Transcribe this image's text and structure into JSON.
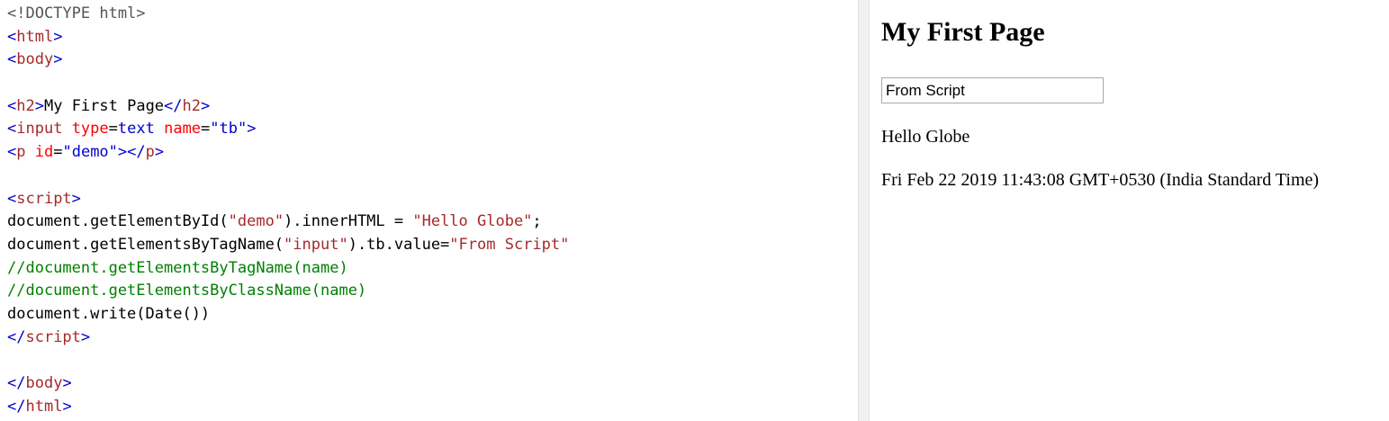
{
  "editor": {
    "lines": [
      [
        {
          "t": "<!DOCTYPE html>",
          "c": "doctype"
        }
      ],
      [
        {
          "t": "<",
          "c": "bracket"
        },
        {
          "t": "html",
          "c": "tag"
        },
        {
          "t": ">",
          "c": "bracket"
        }
      ],
      [
        {
          "t": "<",
          "c": "bracket"
        },
        {
          "t": "body",
          "c": "tag"
        },
        {
          "t": ">",
          "c": "bracket"
        }
      ],
      [],
      [
        {
          "t": "<",
          "c": "bracket"
        },
        {
          "t": "h2",
          "c": "tag"
        },
        {
          "t": ">",
          "c": "bracket"
        },
        {
          "t": "My First Page",
          "c": "plain"
        },
        {
          "t": "</",
          "c": "bracket"
        },
        {
          "t": "h2",
          "c": "tag"
        },
        {
          "t": ">",
          "c": "bracket"
        }
      ],
      [
        {
          "t": "<",
          "c": "bracket"
        },
        {
          "t": "input",
          "c": "tag"
        },
        {
          "t": " ",
          "c": "plain"
        },
        {
          "t": "type",
          "c": "attr"
        },
        {
          "t": "=",
          "c": "plain"
        },
        {
          "t": "text",
          "c": "value"
        },
        {
          "t": " ",
          "c": "plain"
        },
        {
          "t": "name",
          "c": "attr"
        },
        {
          "t": "=",
          "c": "plain"
        },
        {
          "t": "\"tb\"",
          "c": "value"
        },
        {
          "t": ">",
          "c": "bracket"
        }
      ],
      [
        {
          "t": "<",
          "c": "bracket"
        },
        {
          "t": "p",
          "c": "tag"
        },
        {
          "t": " ",
          "c": "plain"
        },
        {
          "t": "id",
          "c": "attr"
        },
        {
          "t": "=",
          "c": "plain"
        },
        {
          "t": "\"demo\"",
          "c": "value"
        },
        {
          "t": "></",
          "c": "bracket"
        },
        {
          "t": "p",
          "c": "tag"
        },
        {
          "t": ">",
          "c": "bracket"
        }
      ],
      [],
      [
        {
          "t": "<",
          "c": "bracket"
        },
        {
          "t": "script",
          "c": "tag"
        },
        {
          "t": ">",
          "c": "bracket"
        }
      ],
      [
        {
          "t": "document.getElementById(",
          "c": "plain"
        },
        {
          "t": "\"demo\"",
          "c": "string"
        },
        {
          "t": ").innerHTML = ",
          "c": "plain"
        },
        {
          "t": "\"Hello Globe\"",
          "c": "string"
        },
        {
          "t": ";",
          "c": "plain"
        }
      ],
      [
        {
          "t": "document.getElementsByTagName(",
          "c": "plain"
        },
        {
          "t": "\"input\"",
          "c": "string"
        },
        {
          "t": ").tb.value=",
          "c": "plain"
        },
        {
          "t": "\"From Script\"",
          "c": "string"
        }
      ],
      [
        {
          "t": "//document.getElementsByTagName(name)",
          "c": "comment"
        }
      ],
      [
        {
          "t": "//document.getElementsByClassName(name)",
          "c": "comment"
        }
      ],
      [
        {
          "t": "document.write(Date())",
          "c": "plain"
        }
      ],
      [
        {
          "t": "</",
          "c": "bracket"
        },
        {
          "t": "script",
          "c": "tag"
        },
        {
          "t": ">",
          "c": "bracket"
        }
      ],
      [],
      [
        {
          "t": "</",
          "c": "bracket"
        },
        {
          "t": "body",
          "c": "tag"
        },
        {
          "t": ">",
          "c": "bracket"
        }
      ],
      [
        {
          "t": "</",
          "c": "bracket"
        },
        {
          "t": "html",
          "c": "tag"
        },
        {
          "t": ">",
          "c": "bracket"
        }
      ]
    ]
  },
  "preview": {
    "heading": "My First Page",
    "input_value": "From Script",
    "paragraph": "Hello Globe",
    "date_output": "Fri Feb 22 2019 11:43:08 GMT+0530 (India Standard Time)"
  },
  "colors": {
    "tag": "#a52a2a",
    "bracket": "#0000cd",
    "attr": "#ff0000",
    "value": "#0000cd",
    "string": "#a52a2a",
    "comment": "#008000",
    "doctype": "#555555",
    "plain": "#000000"
  }
}
